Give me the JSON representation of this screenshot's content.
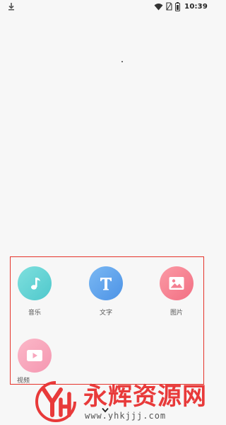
{
  "status_bar": {
    "time": "10:39",
    "icons": [
      "download-icon",
      "wifi-icon",
      "no-sim-icon",
      "battery-icon"
    ]
  },
  "menu": {
    "items": [
      {
        "label": "音乐",
        "icon": "music-note-icon",
        "color": "#5fd0d2"
      },
      {
        "label": "文字",
        "icon": "text-t-icon",
        "color": "#5ea2ec"
      },
      {
        "label": "图片",
        "icon": "image-icon",
        "color": "#f47f91"
      },
      {
        "label": "视频",
        "icon": "play-video-icon",
        "color": "#f7a6bd"
      }
    ]
  },
  "highlight_color": "#e5342b",
  "collapse_icon": "chevron-down-icon",
  "watermark": {
    "brand": "永辉资源网",
    "url": "www.yhkjjj.com",
    "logo_text": "YH",
    "color": "#e83a3a"
  }
}
